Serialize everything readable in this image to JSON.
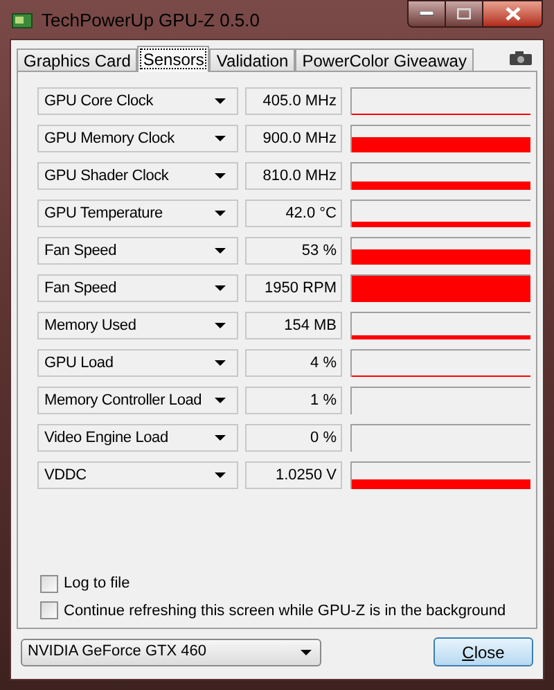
{
  "window": {
    "title": "TechPowerUp GPU-Z 0.5.0"
  },
  "tabs": [
    {
      "label": "Graphics Card",
      "selected": false
    },
    {
      "label": "Sensors",
      "selected": true
    },
    {
      "label": "Validation",
      "selected": false
    },
    {
      "label": "PowerColor Giveaway",
      "selected": false
    }
  ],
  "sensors": [
    {
      "name": "GPU Core Clock",
      "reading": "405.0 MHz"
    },
    {
      "name": "GPU Memory Clock",
      "reading": "900.0 MHz"
    },
    {
      "name": "GPU Shader Clock",
      "reading": "810.0 MHz"
    },
    {
      "name": "GPU Temperature",
      "reading": "42.0 °C"
    },
    {
      "name": "Fan Speed",
      "reading": "53 %"
    },
    {
      "name": "Fan Speed",
      "reading": "1950 RPM"
    },
    {
      "name": "Memory Used",
      "reading": "154 MB"
    },
    {
      "name": "GPU Load",
      "reading": "4 %"
    },
    {
      "name": "Memory Controller Load",
      "reading": "1 %"
    },
    {
      "name": "Video Engine Load",
      "reading": "0 %"
    },
    {
      "name": "VDDC",
      "reading": "1.0250 V"
    }
  ],
  "options": [
    {
      "label": "Log to file",
      "checked": false
    },
    {
      "label": "Continue refreshing this screen while GPU-Z is in the background",
      "checked": false
    }
  ],
  "gpu_select": {
    "value": "NVIDIA GeForce GTX 460"
  },
  "close_button": {
    "label": "Close"
  }
}
